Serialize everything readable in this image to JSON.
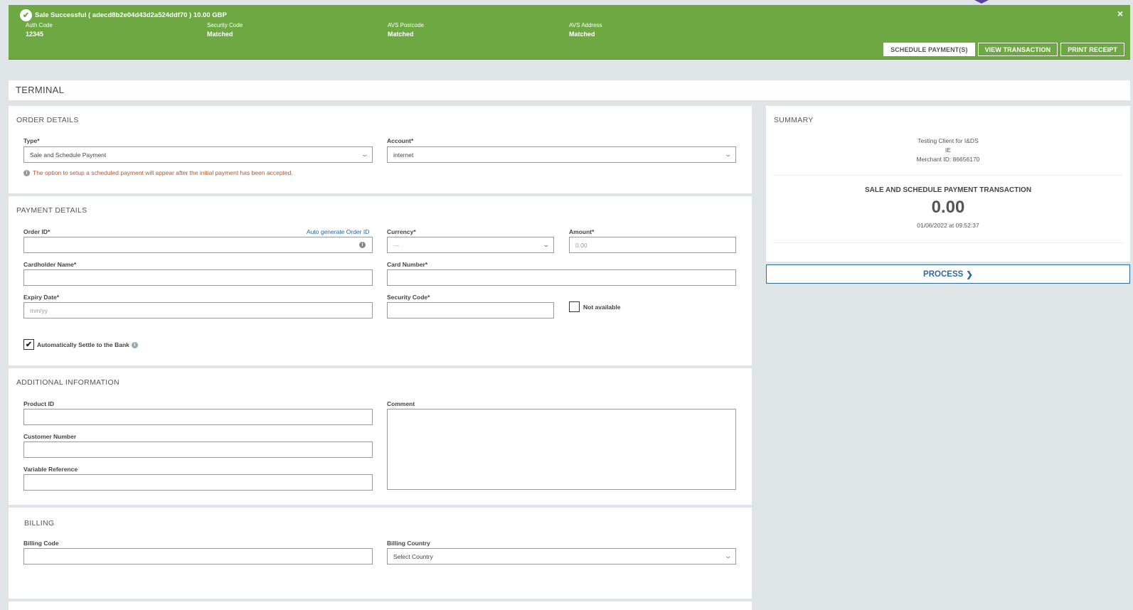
{
  "banner": {
    "title": "Sale Successful ( adecd8b2e04d43d2a524ddf70 ) 10.00 GBP",
    "close": "×",
    "fields": [
      {
        "label": "Auth Code",
        "value": "12345"
      },
      {
        "label": "Security Code",
        "value": "Matched"
      },
      {
        "label": "AVS Postcode",
        "value": "Matched"
      },
      {
        "label": "AVS Address",
        "value": "Matched"
      }
    ],
    "buttons": {
      "schedule": "SCHEDULE PAYMENT(S)",
      "view": "VIEW TRANSACTION",
      "print": "PRINT RECEIPT"
    }
  },
  "terminal": {
    "title": "TERMINAL"
  },
  "order": {
    "title": "ORDER DETAILS",
    "type_label": "Type*",
    "type_value": "Sale and Schedule Payment",
    "account_label": "Account*",
    "account_value": "internet",
    "note": "The option to setup a scheduled payment will appear after the initial payment has been accepted."
  },
  "payment": {
    "title": "PAYMENT DETAILS",
    "order_id_label": "Order ID*",
    "auto_generate": "Auto generate Order ID",
    "currency_label": "Currency*",
    "currency_value": "---",
    "amount_label": "Amount*",
    "amount_placeholder": "0.00",
    "cardholder_label": "Cardholder Name*",
    "card_number_label": "Card Number*",
    "expiry_label": "Expiry Date*",
    "expiry_placeholder": "mm/yy",
    "security_label": "Security Code*",
    "not_available": "Not available",
    "auto_settle": "Automatically Settle to the Bank",
    "auto_settle_checked": true
  },
  "additional": {
    "title": "ADDITIONAL INFORMATION",
    "product_id": "Product ID",
    "customer_number": "Customer Number",
    "variable_reference": "Variable Reference",
    "comment": "Comment"
  },
  "billing": {
    "title": "BILLING",
    "code_label": "Billing Code",
    "country_label": "Billing Country",
    "country_value": "Select Country"
  },
  "summary": {
    "title": "SUMMARY",
    "client": "Testing Client for I&DS",
    "country": "IE",
    "merchant": "Merchant ID: 86656170",
    "transaction_type": "SALE AND SCHEDULE PAYMENT TRANSACTION",
    "amount": "0.00",
    "datetime": "01/06/2022 at 09:52:37",
    "process": "PROCESS"
  },
  "colors": {
    "success": "#6da842",
    "accent": "#2f6d94",
    "note": "#b0582a"
  }
}
